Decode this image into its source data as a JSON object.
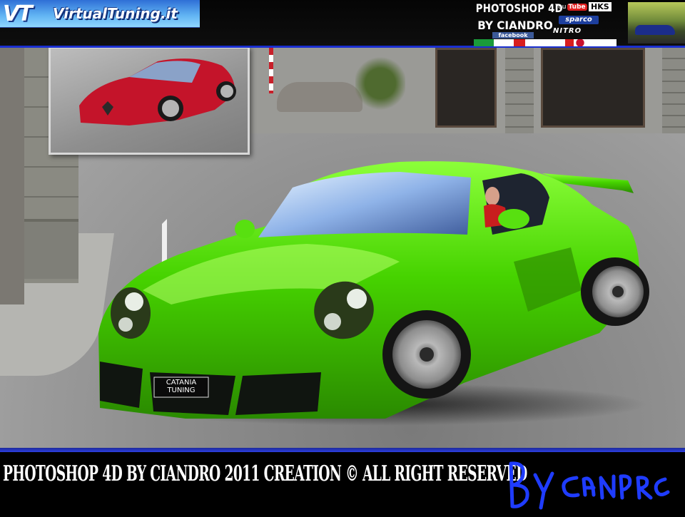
{
  "header": {
    "site_logo_text": "VirtualTuning.it",
    "site_logo_mark": "VT",
    "title_line1": "PHOTOSHOP 4D",
    "title_line2": "BY CIANDRO",
    "facebook_badge": "facebook",
    "sponsor_youtube_you": "You",
    "sponsor_youtube_tube": "Tube",
    "sponsor_hks": "HKS",
    "sponsor_sparco": "sparco",
    "sponsor_nitro": "NITRO"
  },
  "scene": {
    "car_color": "#46d300",
    "car_color_highlight": "#8cff3a",
    "inset_car_color": "#c4142a",
    "license_plate_line1": "CATANIA",
    "license_plate_line2": "TUNING"
  },
  "footer": {
    "caption": "PHOTOSHOP 4D BY CIANDRO 2011 CREATION   ©   ALL RIGHT RESERVED",
    "signature": "BY CIANDRO",
    "accent_color": "#2b3ee0",
    "signature_color": "#1f3cff"
  }
}
